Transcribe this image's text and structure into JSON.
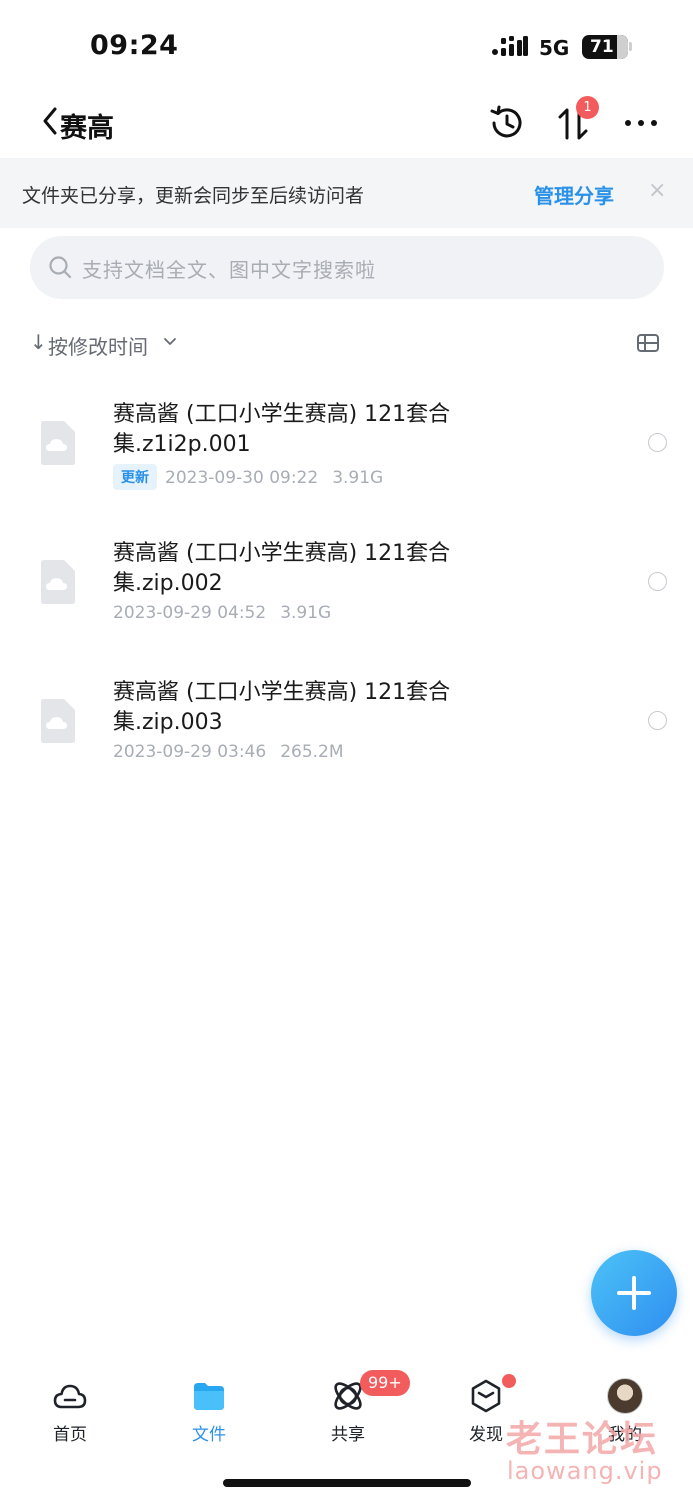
{
  "status_bar": {
    "time": "09:24",
    "network": "5G",
    "battery": "71"
  },
  "header": {
    "title": "赛高",
    "transfer_badge": "1"
  },
  "share_banner": {
    "text": "文件夹已分享，更新会同步至后续访问者",
    "action": "管理分享",
    "close": "×"
  },
  "search": {
    "placeholder": "支持文档全文、图中文字搜索啦"
  },
  "sort": {
    "arrow": "↓",
    "label": "按修改时间"
  },
  "files": [
    {
      "name": "赛高酱 (工口小学生赛高) 121套合集.z1i2p.001",
      "tag": "更新",
      "date": "2023-09-30 09:22",
      "size": "3.91G"
    },
    {
      "name": "赛高酱 (工口小学生赛高) 121套合集.zip.002",
      "tag": "",
      "date": "2023-09-29 04:52",
      "size": "3.91G"
    },
    {
      "name": "赛高酱 (工口小学生赛高) 121套合集.zip.003",
      "tag": "",
      "date": "2023-09-29 03:46",
      "size": "265.2M"
    }
  ],
  "bottom_nav": {
    "items": [
      {
        "label": "首页",
        "icon": "cloud-home-icon"
      },
      {
        "label": "文件",
        "icon": "folder-icon"
      },
      {
        "label": "共享",
        "icon": "share-orbit-icon"
      },
      {
        "label": "发现",
        "icon": "discover-box-icon"
      },
      {
        "label": "我的",
        "icon": "avatar"
      }
    ],
    "share_badge": "99+"
  },
  "watermark": {
    "cn": "老王论坛",
    "url": "laowang.vip"
  },
  "colors": {
    "accent": "#2a91e8",
    "badge": "#f25c5c",
    "banner_bg": "#f4f5f7"
  }
}
